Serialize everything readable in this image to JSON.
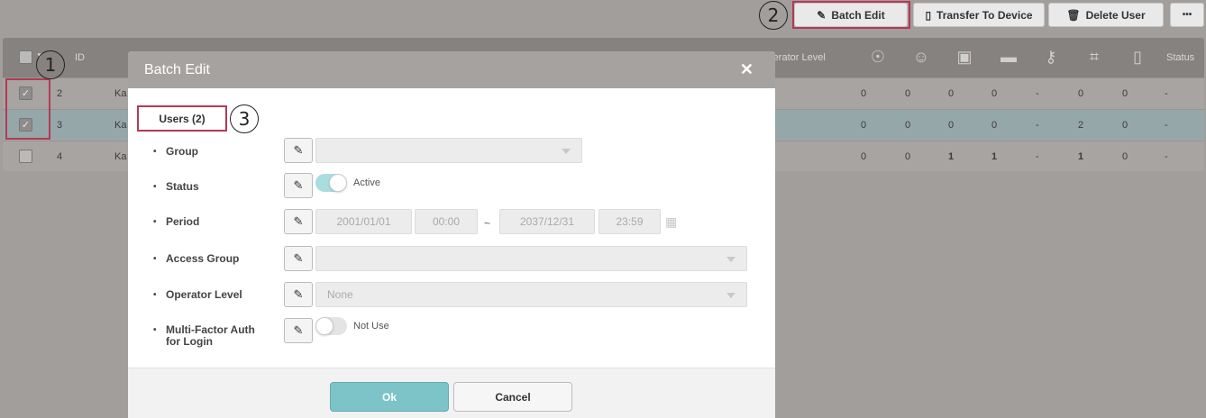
{
  "toolbar": {
    "batch_edit": "Batch Edit",
    "transfer": "Transfer To Device",
    "delete_user": "Delete User",
    "more": "•••"
  },
  "callouts": {
    "one": "1",
    "two": "2",
    "three": "3"
  },
  "table": {
    "headers": {
      "id": "ID",
      "operator_level": "Operator Level",
      "status": "Status"
    },
    "rows": [
      {
        "id": "2",
        "name": "Ka",
        "checked": true,
        "cols": [
          "0",
          "0",
          "0",
          "0",
          "-",
          "0",
          "0",
          "-"
        ]
      },
      {
        "id": "3",
        "name": "Ka",
        "checked": true,
        "cols": [
          "0",
          "0",
          "0",
          "0",
          "-",
          "2",
          "0",
          "-"
        ]
      },
      {
        "id": "4",
        "name": "Ka",
        "checked": false,
        "cols": [
          "0",
          "0",
          "1",
          "1",
          "-",
          "1",
          "0",
          "-"
        ]
      }
    ]
  },
  "modal": {
    "title": "Batch Edit",
    "close": "✕",
    "tab": "Users (2)",
    "fields": {
      "group": "Group",
      "status": "Status",
      "status_value": "Active",
      "period": "Period",
      "start_date": "2001/01/01",
      "start_time": "00:00",
      "tilde": "~",
      "end_date": "2037/12/31",
      "end_time": "23:59",
      "access_group": "Access Group",
      "operator_level": "Operator Level",
      "operator_value": "None",
      "mfa_line1": "Multi-Factor Auth",
      "mfa_line2": "for Login",
      "mfa_value": "Not Use"
    },
    "ok": "Ok",
    "cancel": "Cancel"
  },
  "colors": {
    "accent": "#7cc4c8",
    "highlight": "#b23a55"
  }
}
